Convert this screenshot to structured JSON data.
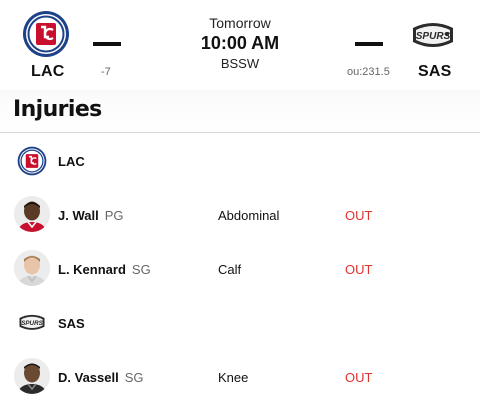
{
  "game": {
    "away": {
      "abbr": "LAC",
      "line": "-7"
    },
    "home": {
      "abbr": "SAS",
      "line": "ou:231.5"
    },
    "day": "Tomorrow",
    "time": "10:00 AM",
    "network": "BSSW"
  },
  "injuries": {
    "title": "Injuries",
    "teams": [
      {
        "abbr": "LAC",
        "players": [
          {
            "name": "J. Wall",
            "pos": "PG",
            "injury": "Abdominal",
            "status": "OUT"
          },
          {
            "name": "L. Kennard",
            "pos": "SG",
            "injury": "Calf",
            "status": "OUT"
          }
        ]
      },
      {
        "abbr": "SAS",
        "players": [
          {
            "name": "D. Vassell",
            "pos": "SG",
            "injury": "Knee",
            "status": "OUT"
          }
        ]
      }
    ]
  },
  "colors": {
    "status_out": "#e0312f",
    "clippers_red": "#c8102e",
    "clippers_blue": "#1d428a"
  }
}
